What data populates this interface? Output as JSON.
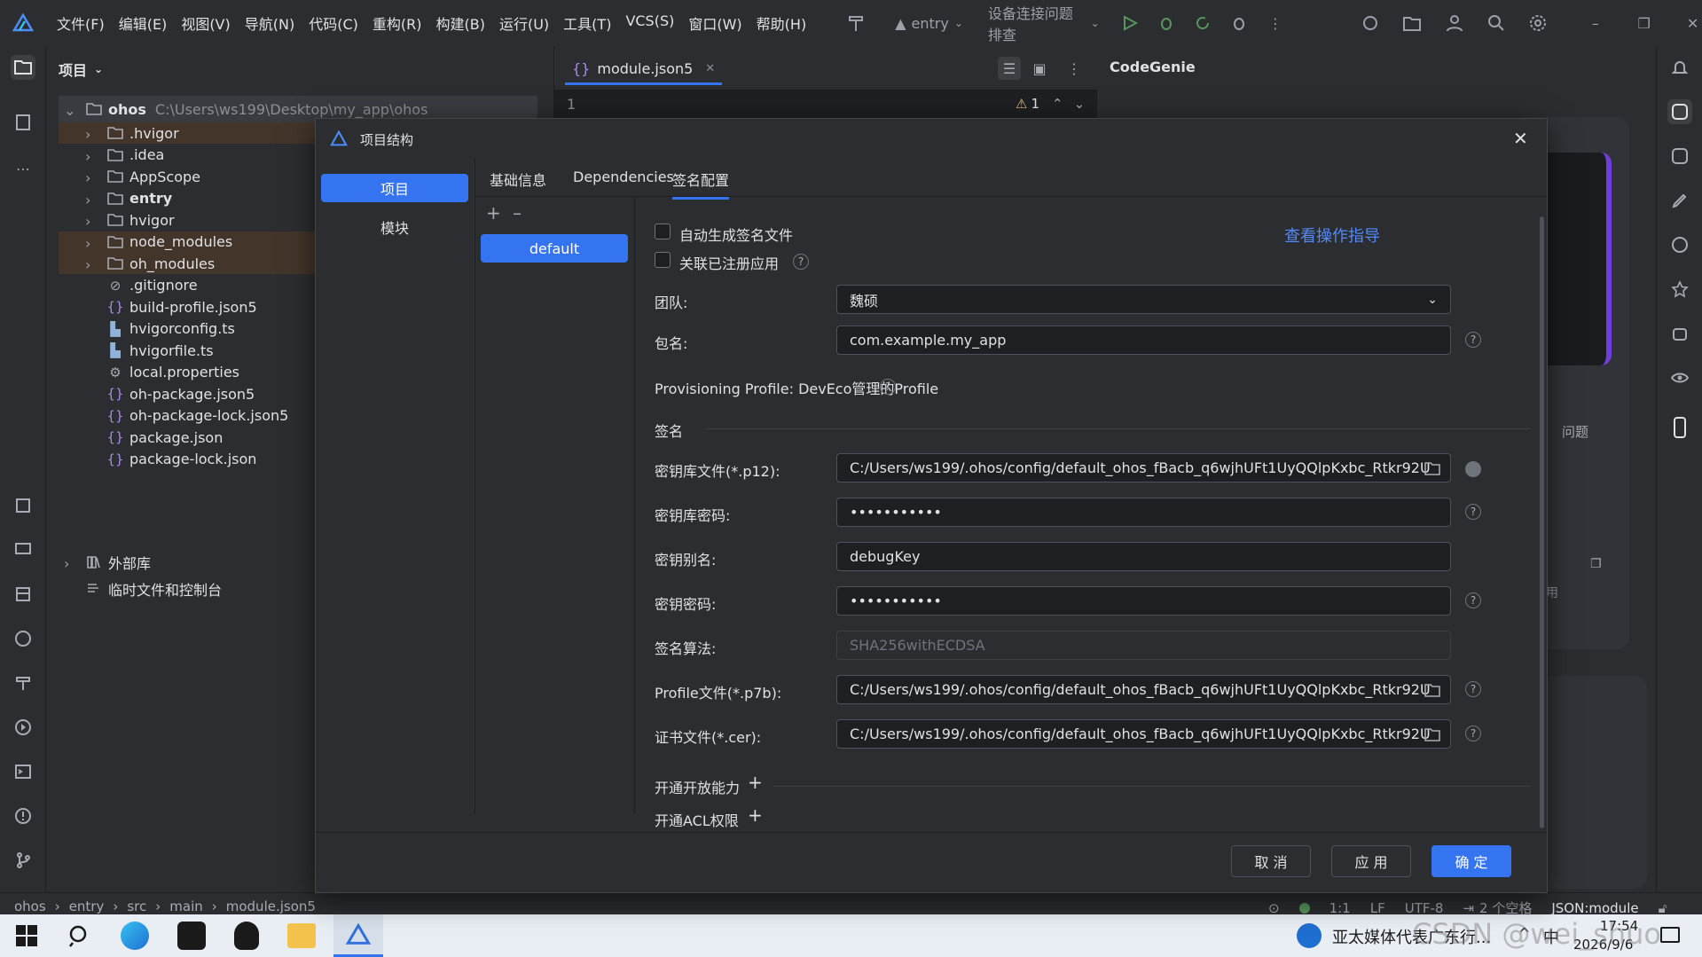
{
  "menu": [
    "文件(F)",
    "编辑(E)",
    "视图(V)",
    "导航(N)",
    "代码(C)",
    "重构(R)",
    "构建(B)",
    "运行(U)",
    "工具(T)",
    "VCS(S)",
    "窗口(W)",
    "帮助(H)"
  ],
  "toolbar": {
    "run_config": "entry",
    "device": "设备连接问题排查"
  },
  "project_panel": {
    "title": "项目",
    "root_name": "ohos",
    "root_path": "C:\\Users\\ws199\\Desktop\\my_app\\ohos",
    "items": [
      ".hvigor",
      ".idea",
      "AppScope",
      "entry",
      "hvigor",
      "node_modules",
      "oh_modules",
      ".gitignore",
      "build-profile.json5",
      "hvigorconfig.ts",
      "hvigorfile.ts",
      "local.properties",
      "oh-package.json5",
      "oh-package-lock.json5",
      "package.json",
      "package-lock.json"
    ],
    "external_libs": "外部库",
    "scratches": "临时文件和控制台"
  },
  "editor": {
    "tab_label": "module.json5",
    "line_number": "1",
    "warning_count": "1"
  },
  "codegenie": {
    "title": "CodeGenie",
    "snippet_1": "问题",
    "snippet_2": "用"
  },
  "dialog": {
    "title": "项目结构",
    "nav": [
      "项目",
      "模块"
    ],
    "tabs": [
      "基础信息",
      "Dependencies",
      "签名配置"
    ],
    "config_item": "default",
    "auto_generate": "自动生成签名文件",
    "link_registered": "关联已注册应用",
    "guide_link": "查看操作指导",
    "team_label": "团队:",
    "team_value": "魏硕",
    "bundle_label": "包名:",
    "bundle_value": "com.example.my_app",
    "provisioning": "Provisioning Profile: DevEco管理的Profile",
    "sign_section": "签名",
    "store_file_label": "密钥库文件(*.p12):",
    "store_file_value": "C:/Users/ws199/.ohos/config/default_ohos_fBacb_q6wjhUFt1UyQQlpKxbc_Rtkr92U",
    "store_pwd_label": "密钥库密码:",
    "store_pwd_value": "•••••••••••",
    "key_alias_label": "密钥别名:",
    "key_alias_value": "debugKey",
    "key_pwd_label": "密钥密码:",
    "key_pwd_value": "•••••••••••",
    "algo_label": "签名算法:",
    "algo_value": "SHA256withECDSA",
    "profile_label": "Profile文件(*.p7b):",
    "profile_value": "C:/Users/ws199/.ohos/config/default_ohos_fBacb_q6wjhUFt1UyQQlpKxbc_Rtkr92U",
    "cert_label": "证书文件(*.cer):",
    "cert_value": "C:/Users/ws199/.ohos/config/default_ohos_fBacb_q6wjhUFt1UyQQlpKxbc_Rtkr92U",
    "open_capability": "开通开放能力",
    "open_acl": "开通ACL权限",
    "cancel": "取 消",
    "apply": "应 用",
    "ok": "确 定"
  },
  "statusbar": {
    "breadcrumb": [
      "ohos",
      "entry",
      "src",
      "main",
      "module.json5"
    ],
    "position": "1:1",
    "line_sep": "LF",
    "encoding": "UTF-8",
    "indent": "2 个空格",
    "schema": "JSON:module"
  },
  "taskbar": {
    "notification": "亚太媒体代表广东行...",
    "time": "17:54",
    "date": "2026/9/6",
    "watermark": "CSDN @wei_shuo"
  },
  "colors": {
    "accent": "#3574f0",
    "selected_folder": "#43352a",
    "dialog_bg": "#2b2d30",
    "editor_bg": "#1e1f22"
  }
}
